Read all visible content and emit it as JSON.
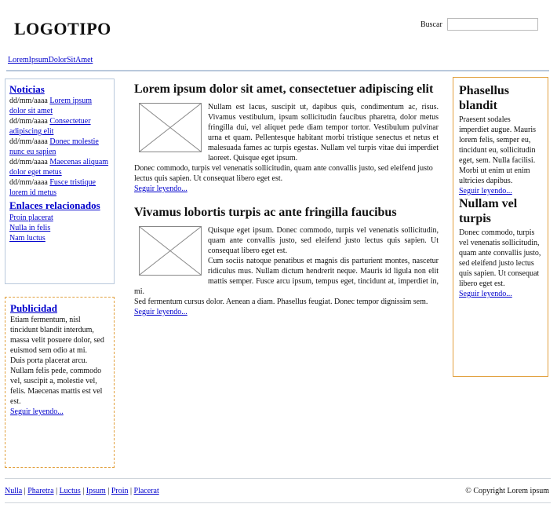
{
  "header": {
    "logo": "LOGOTIPO",
    "search_label": "Buscar",
    "search_value": "",
    "top_link": "LoremIpsumDolorSitAmet"
  },
  "left": {
    "news": {
      "title": "Noticias",
      "items": [
        {
          "date": "dd/mm/aaaa",
          "link": "Lorem ipsum dolor sit amet"
        },
        {
          "date": "dd/mm/aaaa",
          "link": "Consectetuer adipiscing elit"
        },
        {
          "date": "dd/mm/aaaa",
          "link": "Donec molestie nunc eu sapien"
        },
        {
          "date": "dd/mm/aaaa",
          "link": "Maecenas aliquam dolor eget metus"
        },
        {
          "date": "dd/mm/aaaa",
          "link": "Fusce tristique lorem id metus"
        }
      ],
      "related_title": "Enlaces relacionados",
      "related": [
        "Proin placerat",
        "Nulla in felis",
        "Nam luctus"
      ]
    },
    "ads": {
      "title": "Publicidad",
      "p1": "Etiam fermentum, nisl tincidunt blandit interdum, massa velit posuere dolor, sed euismod sem odio at mi.",
      "p2": "Duis porta placerat arcu. Nullam felis pede, commodo vel, suscipit a, molestie vel, felis. Maecenas mattis est vel est.",
      "more": "Seguir leyendo..."
    }
  },
  "main": {
    "articles": [
      {
        "title": "Lorem ipsum dolor sit amet, consectetuer adipiscing elit",
        "p1": "Nullam est lacus, suscipit ut, dapibus quis, condimentum ac, risus. Vivamus vestibulum, ipsum sollicitudin faucibus pharetra, dolor metus fringilla dui, vel aliquet pede diam tempor tortor. Vestibulum pulvinar urna et quam. Pellentesque habitant morbi tristique senectus et netus et malesuada fames ac turpis egestas. Nullam vel turpis vitae dui imperdiet laoreet. Quisque eget ipsum.",
        "p2": "Donec commodo, turpis vel venenatis sollicitudin, quam ante convallis justo, sed eleifend justo lectus quis sapien. Ut consequat libero eget est.",
        "more": "Seguir leyendo..."
      },
      {
        "title": "Vivamus lobortis turpis ac ante fringilla faucibus",
        "p1": "Quisque eget ipsum. Donec commodo, turpis vel venenatis sollicitudin, quam ante convallis justo, sed eleifend justo lectus quis sapien. Ut consequat libero eget est.",
        "p2": "Cum sociis natoque penatibus et magnis dis parturient montes, nascetur ridiculus mus. Nullam dictum hendrerit neque. Mauris id ligula non elit mattis semper. Fusce arcu ipsum, tempus eget, tincidunt at, imperdiet in, mi.",
        "p3": "Sed fermentum cursus dolor. Aenean a diam. Phasellus feugiat. Donec tempor dignissim sem.",
        "more": "Seguir leyendo..."
      }
    ]
  },
  "right": {
    "sections": [
      {
        "title": "Phasellus blandit",
        "text": "Praesent sodales imperdiet augue. Mauris lorem felis, semper eu, tincidunt eu, sollicitudin eget, sem. Nulla facilisi. Morbi ut enim ut enim ultricies dapibus.",
        "more": "Seguir leyendo..."
      },
      {
        "title": "Nullam vel turpis",
        "text": "Donec commodo, turpis vel venenatis sollicitudin, quam ante convallis justo, sed eleifend justo lectus quis sapien. Ut consequat libero eget est.",
        "more": "Seguir leyendo..."
      }
    ]
  },
  "footer": {
    "links": [
      "Nulla",
      "Pharetra",
      "Luctus",
      "Ipsum",
      "Proin",
      "Placerat"
    ],
    "copyright": "© Copyright Lorem ipsum"
  }
}
